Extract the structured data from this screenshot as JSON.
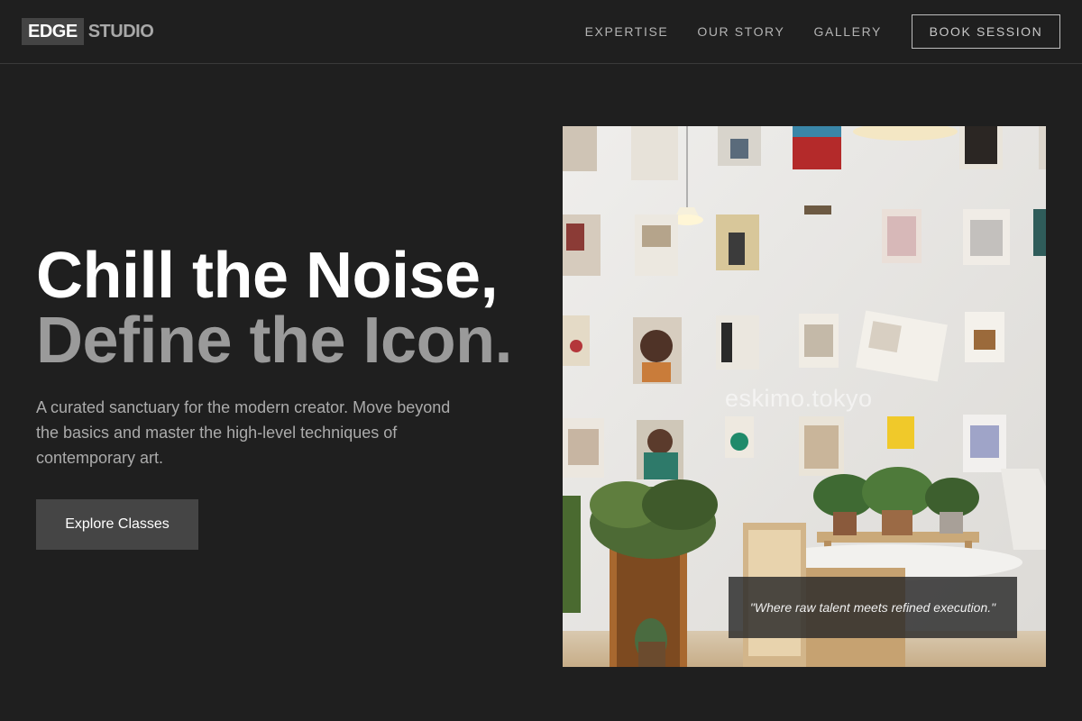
{
  "brand": {
    "box": "EDGE",
    "rest": "STUDIO"
  },
  "nav": {
    "links": [
      "EXPERTISE",
      "OUR STORY",
      "GALLERY"
    ],
    "cta": "BOOK SESSION"
  },
  "hero": {
    "headline_line1": "Chill the Noise,",
    "headline_line2": "Define the Icon.",
    "subtext": "A curated sanctuary for the modern creator. Move beyond the basics and master the high-level techniques of contemporary art.",
    "button": "Explore Classes"
  },
  "photo": {
    "watermark": "eskimo.tokyo",
    "quote": "\"Where raw talent meets refined execution.\""
  },
  "colors": {
    "background": "#1f1f1f",
    "headline_primary": "#ffffff",
    "headline_secondary": "#9a9a9a",
    "button_bg": "#454545"
  }
}
